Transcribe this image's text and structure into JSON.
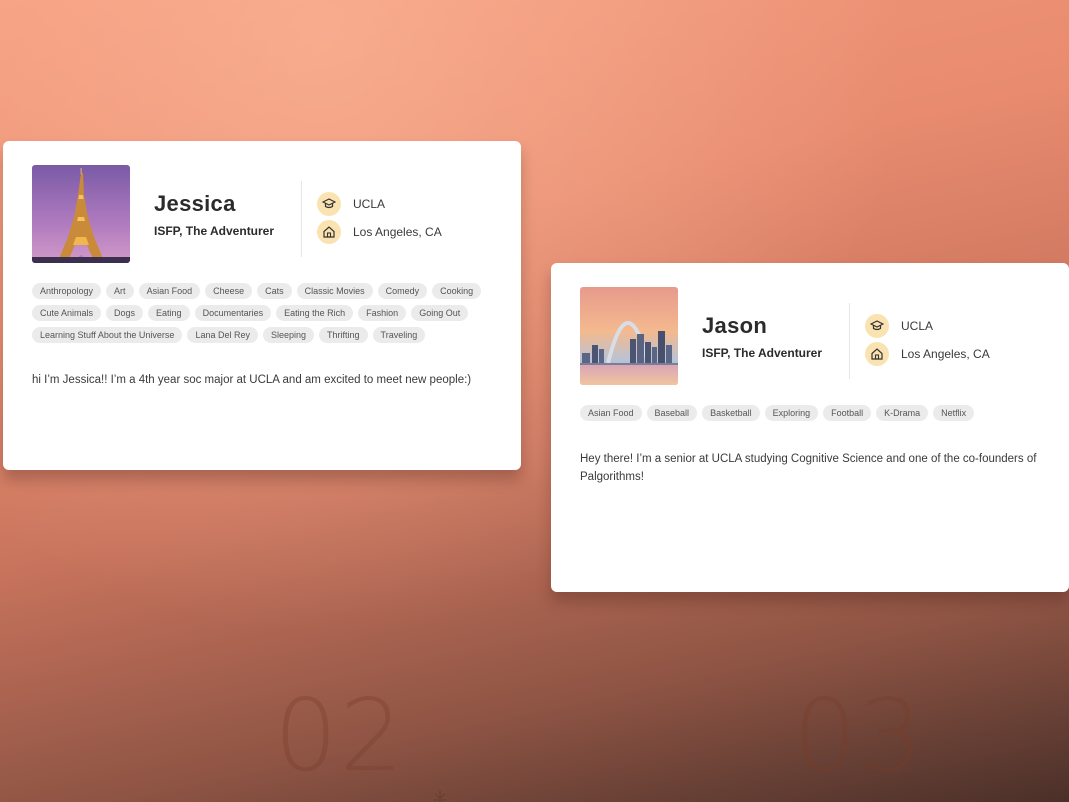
{
  "profiles": [
    {
      "name": "Jessica",
      "type": "ISFP, The Adventurer",
      "school": "UCLA",
      "location": "Los Angeles, CA",
      "photo": "eiffel-tower-photo",
      "tags": [
        "Anthropology",
        "Art",
        "Asian Food",
        "Cheese",
        "Cats",
        "Classic Movies",
        "Comedy",
        "Cooking",
        "Cute Animals",
        "Dogs",
        "Eating",
        "Documentaries",
        "Eating the Rich",
        "Fashion",
        "Going Out",
        "Learning Stuff About the Universe",
        "Lana Del Rey",
        "Sleeping",
        "Thrifting",
        "Traveling"
      ],
      "bio": "hi I’m Jessica!! I’m a 4th year soc major at UCLA and am excited to meet new people:)"
    },
    {
      "name": "Jason",
      "type": "ISFP, The Adventurer",
      "school": "UCLA",
      "location": "Los Angeles, CA",
      "photo": "gateway-arch-photo",
      "tags": [
        "Asian Food",
        "Baseball",
        "Basketball",
        "Exploring",
        "Football",
        "K-Drama",
        "Netflix"
      ],
      "bio": "Hey there! I’m a senior at UCLA studying Cognitive Science and one of the co-founders of Palgorithms!"
    }
  ],
  "step_numbers": [
    "02",
    "03"
  ],
  "icons": {
    "school": "graduation-cap-icon",
    "home": "house-icon"
  },
  "colors": {
    "icon_bg": "#fbe3b1",
    "tag_bg": "#ebebeb",
    "card_bg": "#ffffff",
    "bg_top": "#f49a7c",
    "bg_bottom": "#4a3029"
  }
}
